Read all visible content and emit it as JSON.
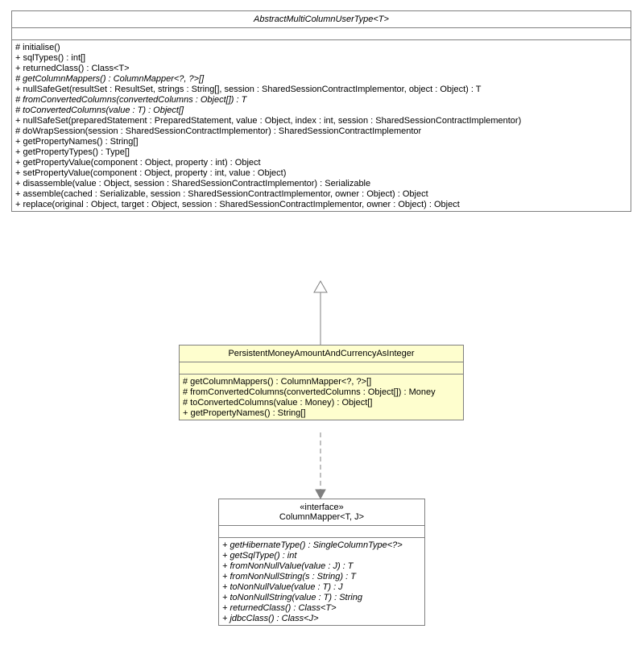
{
  "classes": {
    "abstractMulti": {
      "title": "AbstractMultiColumnUserType<T>",
      "members": [
        "# initialise()",
        "+ sqlTypes() : int[]",
        "+ returnedClass() : Class<T>",
        "+ nullSafeGet(resultSet : ResultSet, strings : String[], session : SharedSessionContractImplementor, object : Object) : T",
        "+ nullSafeSet(preparedStatement : PreparedStatement, value : Object, index : int, session : SharedSessionContractImplementor)",
        "# doWrapSession(session : SharedSessionContractImplementor) : SharedSessionContractImplementor",
        "+ getPropertyNames() : String[]",
        "+ getPropertyTypes() : Type[]",
        "+ getPropertyValue(component : Object, property : int) : Object",
        "+ setPropertyValue(component : Object, property : int, value : Object)",
        "+ disassemble(value : Object, session : SharedSessionContractImplementor) : Serializable",
        "+ assemble(cached : Serializable, session : SharedSessionContractImplementor, owner : Object) : Object",
        "+ replace(original : Object, target : Object, session : SharedSessionContractImplementor, owner : Object) : Object"
      ],
      "abstractMembers": [
        "# getColumnMappers() : ColumnMapper<?, ?>[]",
        "# fromConvertedColumns(convertedColumns : Object[]) : T",
        "# toConvertedColumns(value : T) : Object[]"
      ]
    },
    "persistentMoney": {
      "title": "PersistentMoneyAmountAndCurrencyAsInteger",
      "members": [
        "# getColumnMappers() : ColumnMapper<?, ?>[]",
        "# fromConvertedColumns(convertedColumns : Object[]) : Money",
        "# toConvertedColumns(value : Money) : Object[]",
        "+ getPropertyNames() : String[]"
      ]
    },
    "columnMapper": {
      "stereotype": "«interface»",
      "title": "ColumnMapper<T, J>",
      "members": [
        "+ getHibernateType() : SingleColumnType<?>",
        "+ getSqlType() : int",
        "+ fromNonNullValue(value : J) : T",
        "+ fromNonNullString(s : String) : T",
        "+ toNonNullValue(value : T) : J",
        "+ toNonNullString(value : T) : String",
        "+ returnedClass() : Class<T>",
        "+ jdbcClass() : Class<J>"
      ]
    }
  },
  "chart_data": {
    "type": "uml_class_diagram",
    "classes": [
      {
        "name": "AbstractMultiColumnUserType<T>",
        "abstract": true
      },
      {
        "name": "PersistentMoneyAmountAndCurrencyAsInteger",
        "highlighted": true
      },
      {
        "name": "ColumnMapper<T, J>",
        "stereotype": "interface"
      }
    ],
    "relations": [
      {
        "from": "PersistentMoneyAmountAndCurrencyAsInteger",
        "to": "AbstractMultiColumnUserType<T>",
        "type": "generalization"
      },
      {
        "from": "PersistentMoneyAmountAndCurrencyAsInteger",
        "to": "ColumnMapper<T, J>",
        "type": "dependency"
      }
    ]
  }
}
